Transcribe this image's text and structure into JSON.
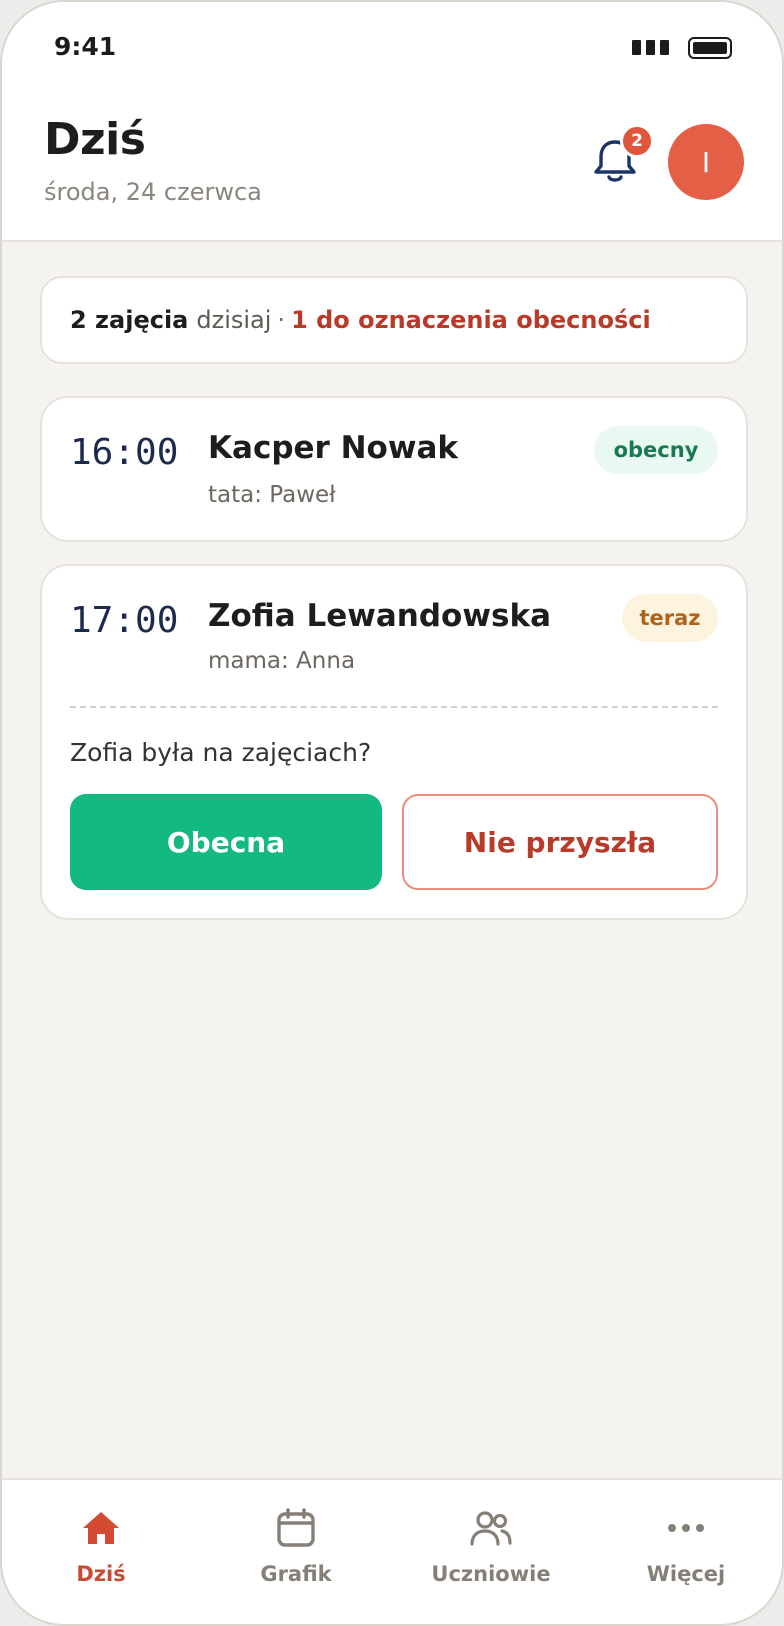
{
  "status_bar": {
    "time": "9:41"
  },
  "header": {
    "title": "Dziś",
    "date": "środa, 24 czerwca",
    "notifications_count": "2",
    "avatar_initial": "I"
  },
  "summary": {
    "count_text": "2 zajęcia",
    "today_text": "dzisiaj",
    "separator": "·",
    "pending_text": "1 do oznaczenia obecności"
  },
  "lessons": [
    {
      "time": "16:00",
      "student": "Kacper Nowak",
      "parent": "tata: Paweł",
      "status": "obecny"
    },
    {
      "time": "17:00",
      "student": "Zofia Lewandowska",
      "parent": "mama: Anna",
      "status": "teraz",
      "question": "Zofia była na zajęciach?",
      "present_label": "Obecna",
      "absent_label": "Nie przyszła"
    }
  ],
  "bottom_nav": [
    {
      "label": "Dziś",
      "icon": "home-icon",
      "active": true
    },
    {
      "label": "Grafik",
      "icon": "calendar-icon",
      "active": false
    },
    {
      "label": "Uczniowie",
      "icon": "users-icon",
      "active": false
    },
    {
      "label": "Więcej",
      "icon": "more-icon",
      "active": false
    }
  ],
  "colors": {
    "accent": "#e45f46",
    "present_button": "#14b982",
    "absent_text": "#b83a29",
    "present_pill_text": "#177a53",
    "now_pill_text": "#b0631a",
    "time_text": "#1c2a4d"
  }
}
